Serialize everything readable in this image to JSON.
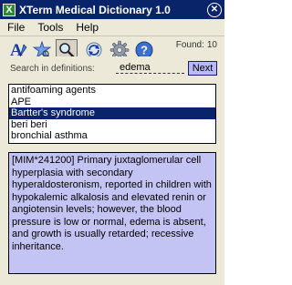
{
  "window": {
    "title": "XTerm Medical Dictionary 1.0",
    "app_icon_letter": "X",
    "close_glyph": "✕"
  },
  "menu": [
    "File",
    "Tools",
    "Help"
  ],
  "toolbar": {
    "icons": [
      "text-a-icon",
      "star-search-icon",
      "magnifier-icon",
      "refresh-cycle-icon",
      "gear-icon",
      "help-icon"
    ],
    "found_label": "Found:",
    "found_count": "10"
  },
  "search": {
    "label": "Search in definitions:",
    "value": "edema",
    "next_label": "Next"
  },
  "results": {
    "items": [
      "antifoaming agents",
      "APE",
      "Bartter's syndrome",
      "beri beri",
      "bronchial asthma"
    ],
    "selected_index": 2
  },
  "definition": {
    "text": "[MIM*241200] Primary juxtaglomerular cell hyperplasia with secondary hyperaldosteronism, reported in children with hypokalemic alkalosis and elevated renin or angiotensin levels; however, the blood pressure is low or normal, edema is absent, and growth is usually retarded; recessive inheritance."
  },
  "colors": {
    "titlebar": "#0a246a",
    "selection": "#0a246a",
    "definition_bg": "#c4c4f4",
    "next_button": "#b9b9f5"
  }
}
